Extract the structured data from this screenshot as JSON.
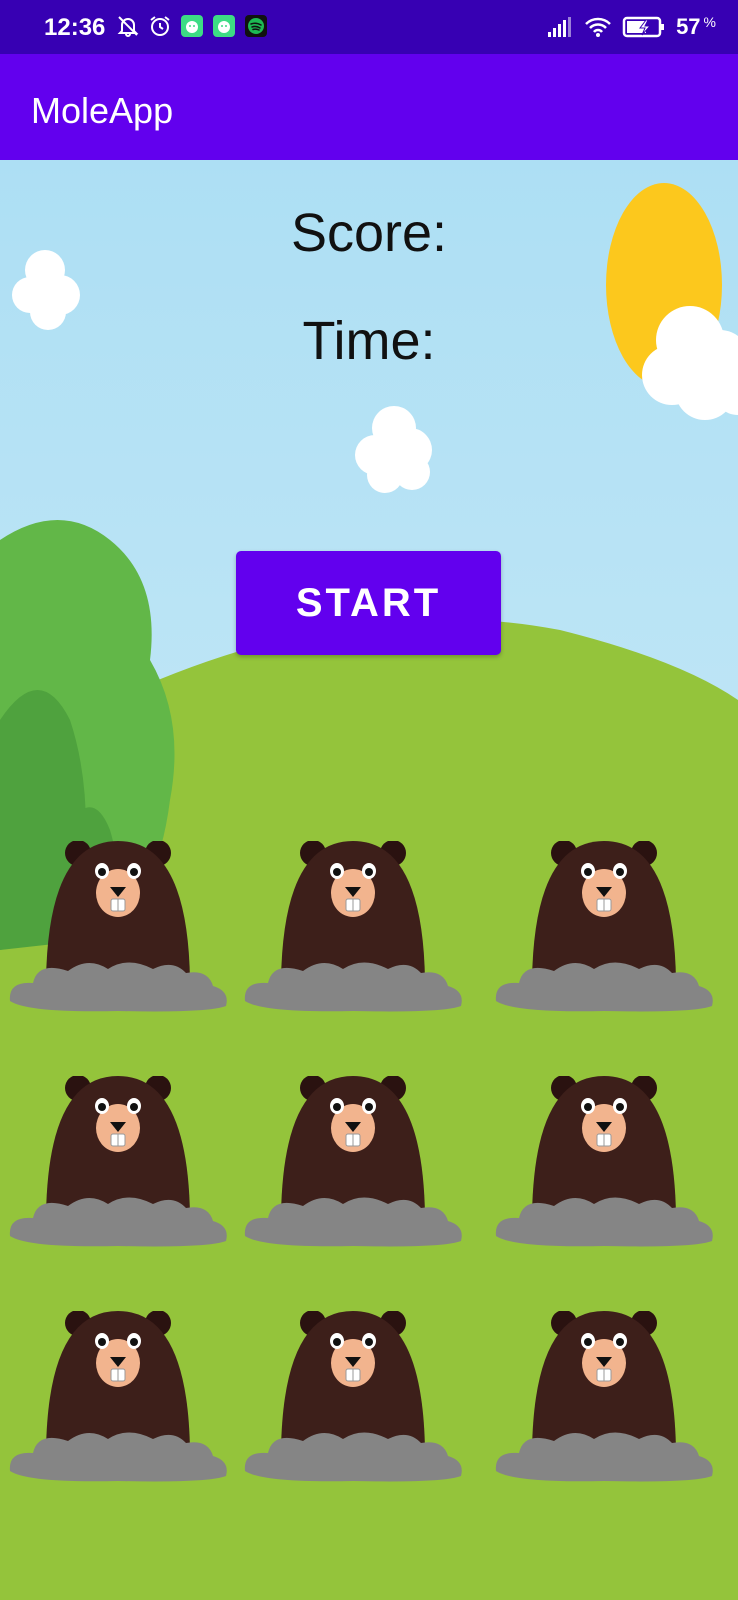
{
  "status_bar": {
    "time": "12:36",
    "battery_percent": "57",
    "battery_unit": "%",
    "icons": [
      "mute-bell-icon",
      "alarm-icon",
      "android-app-icon",
      "android-app-icon",
      "spotify-icon",
      "signal-icon",
      "wifi-icon",
      "battery-charging-icon"
    ]
  },
  "app_bar": {
    "title": "MoleApp",
    "color": "#6200ee"
  },
  "game": {
    "score_label": "Score:",
    "time_label": "Time:",
    "start_label": "START",
    "mole_grid": {
      "rows": 3,
      "cols": 3,
      "count": 9
    }
  },
  "colors": {
    "primary": "#6200ee",
    "status_bar": "#3700b3",
    "sky": "#b5e3f5",
    "grass": "#94c43b",
    "mole": "#3d1f1a",
    "rock": "#858585"
  }
}
